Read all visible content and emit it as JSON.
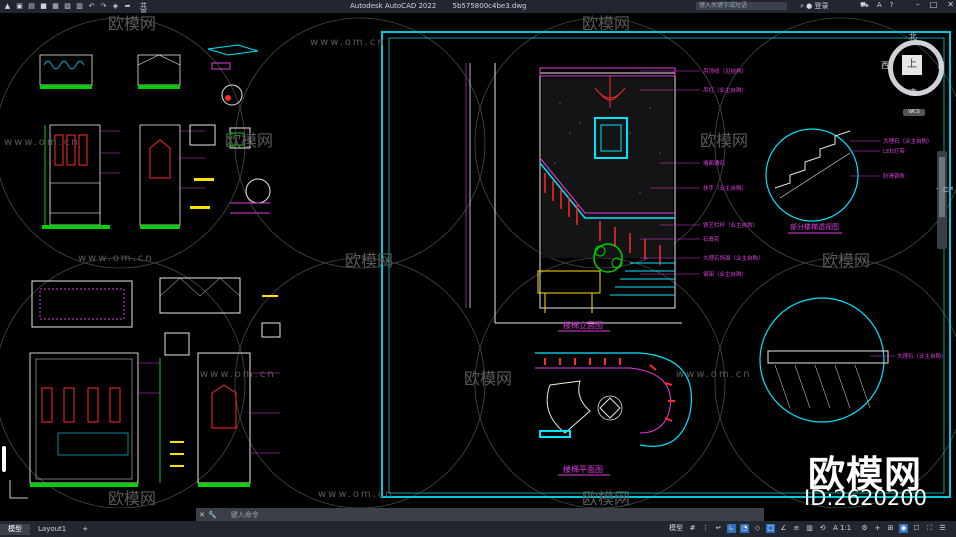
{
  "titlebar": {
    "share_label": "共享",
    "app_name": "Autodesk AutoCAD 2022",
    "document_name": "5b575800c4be3.dwg",
    "search_placeholder": "键入关键字或短语",
    "login_label": "登录"
  },
  "viewcube": {
    "north": "北",
    "south": "南",
    "east": "东",
    "west": "西",
    "top": "上",
    "wcs": "WCS"
  },
  "side_labels": {
    "vp1": "-",
    "vp2": "口",
    "vp3": "x"
  },
  "drawing": {
    "stair_elevation_title": "楼梯立面图",
    "stair_plan_title": "楼梯平面图",
    "detail_title": "部分楼梯透视图",
    "callouts_elevation": [
      "吊顶线（见结构）",
      "吊灯（业主自购）",
      "墙面铺石",
      "扶手（业主自购）",
      "铁艺栏杆（业主自购）",
      "石膏花",
      "大理石饰面（业主自购）",
      "钢架（业主自购）"
    ],
    "callouts_detail": [
      "大理石（业主自购）",
      "LED灯带",
      "防滑铜条"
    ],
    "callout_detail_bottom": "大理石（业主自购）"
  },
  "watermarks": {
    "brand": "欧模网",
    "url": "www.om.cn",
    "id_text": "ID:2620200"
  },
  "command": {
    "placeholder": "键入命令"
  },
  "statusbar": {
    "tab_model": "模型",
    "tab_layout1": "Layout1",
    "tab_add": "+",
    "model_label": "模型",
    "scale": "1:1"
  },
  "colors": {
    "frame": "#00c8d8",
    "magenta": "#e03ce0",
    "red": "#ff2a2a",
    "cyan": "#00e5ff",
    "yellow": "#ffe100",
    "green": "#00d000",
    "white": "#e8e8e8"
  }
}
